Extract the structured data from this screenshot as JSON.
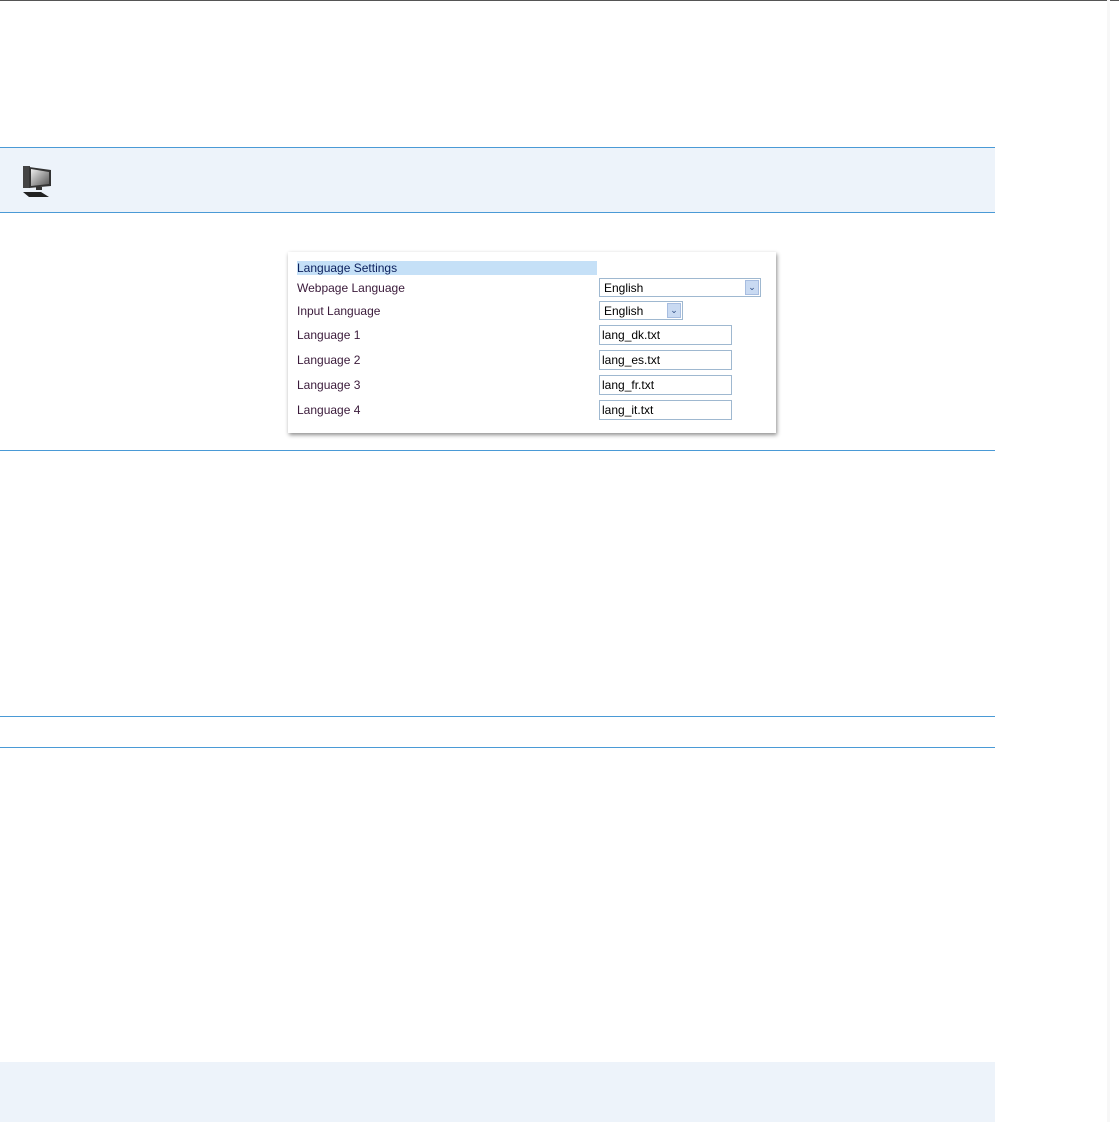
{
  "panel": {
    "header": "Language Settings",
    "webpage_language": {
      "label": "Webpage Language",
      "value": "English"
    },
    "input_language": {
      "label": "Input Language",
      "value": "English"
    },
    "languages": [
      {
        "label": "Language 1",
        "value": "lang_dk.txt"
      },
      {
        "label": "Language 2",
        "value": "lang_es.txt"
      },
      {
        "label": "Language 3",
        "value": "lang_fr.txt"
      },
      {
        "label": "Language 4",
        "value": "lang_it.txt"
      }
    ]
  },
  "icons": {
    "note": "computer-icon"
  },
  "colors": {
    "accent": "#4a9ad6",
    "note_bg": "#edf3fa",
    "header_bg": "#c5e0f7"
  }
}
